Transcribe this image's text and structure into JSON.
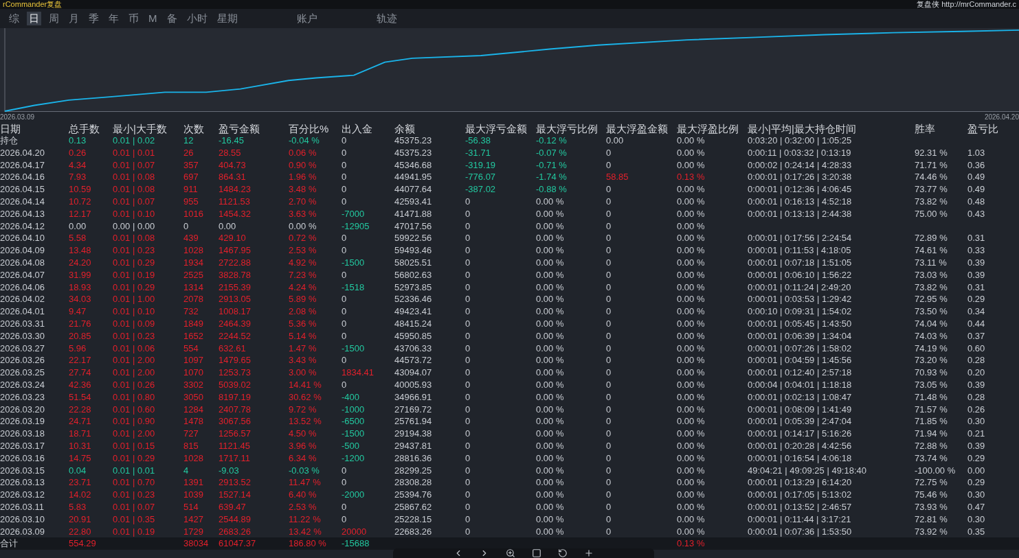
{
  "title_left": "rCommander复盘",
  "title_right": "复盘侠 http://mrCommander.c",
  "period_tabs": [
    {
      "label": "综",
      "selected": false
    },
    {
      "label": "日",
      "selected": true
    },
    {
      "label": "周",
      "selected": false
    },
    {
      "label": "月",
      "selected": false
    },
    {
      "label": "季",
      "selected": false
    },
    {
      "label": "年",
      "selected": false
    },
    {
      "label": "币",
      "selected": false
    },
    {
      "label": "M",
      "selected": false
    },
    {
      "label": "备",
      "selected": false
    },
    {
      "label": "小时",
      "selected": false
    },
    {
      "label": "星期",
      "selected": false
    }
  ],
  "view_tabs": [
    {
      "label": "账户",
      "selected": false
    },
    {
      "label": "轨迹",
      "selected": false
    }
  ],
  "chart": {
    "start_label": "2026.03.09",
    "end_label": "2026.04.20"
  },
  "table": {
    "columns": [
      "日期",
      "总手数",
      "最小|大手数",
      "次数",
      "盈亏金额",
      "百分比%",
      "出入金",
      "余额",
      "最大浮亏金额",
      "最大浮亏比例",
      "最大浮盈金额",
      "最大浮盈比例",
      "最小|平均|最大持仓时间",
      "胜率",
      "盈亏比"
    ],
    "rows": [
      {
        "cells": [
          {
            "text": "持仓"
          },
          {
            "text": "0.13",
            "color": "#22c9a0"
          },
          {
            "text": "0.01 | 0.02",
            "color": "#22c9a0"
          },
          {
            "text": "12",
            "color": "#22c9a0"
          },
          {
            "text": "-16.45",
            "color": "#22c9a0"
          },
          {
            "text": "-0.04 %",
            "color": "#22c9a0"
          },
          {
            "text": "0"
          },
          {
            "text": "45375.23"
          },
          {
            "text": "-56.38",
            "color": "#22c9a0"
          },
          {
            "text": "-0.12 %",
            "color": "#22c9a0"
          },
          {
            "text": "0.00"
          },
          {
            "text": "0.00 %"
          },
          {
            "text": "0:03:20 | 0:32:00 | 1:05:25"
          },
          null,
          null
        ]
      },
      {
        "cells": [
          {
            "text": "2026.04.20"
          },
          {
            "text": "0.26",
            "color": "#e3202b"
          },
          {
            "text": "0.01 | 0.01",
            "color": "#e3202b"
          },
          {
            "text": "26",
            "color": "#e3202b"
          },
          {
            "text": "28.55",
            "color": "#e3202b"
          },
          {
            "text": "0.06 %",
            "color": "#e3202b"
          },
          {
            "text": "0"
          },
          {
            "text": "45375.23"
          },
          {
            "text": "-31.71",
            "color": "#22c9a0"
          },
          {
            "text": "-0.07 %",
            "color": "#22c9a0"
          },
          {
            "text": "0"
          },
          {
            "text": "0.00 %"
          },
          {
            "text": "0:00:11 | 0:03:32 | 0:13:19"
          },
          {
            "text": "92.31 %"
          },
          {
            "text": "1.03"
          }
        ]
      },
      {
        "cells": [
          {
            "text": "2026.04.17"
          },
          {
            "text": "4.34",
            "color": "#e3202b"
          },
          {
            "text": "0.01 | 0.07",
            "color": "#e3202b"
          },
          {
            "text": "357",
            "color": "#e3202b"
          },
          {
            "text": "404.73",
            "color": "#e3202b"
          },
          {
            "text": "0.90 %",
            "color": "#e3202b"
          },
          {
            "text": "0"
          },
          {
            "text": "45346.68"
          },
          {
            "text": "-319.19",
            "color": "#22c9a0"
          },
          {
            "text": "-0.71 %",
            "color": "#22c9a0"
          },
          {
            "text": "0"
          },
          {
            "text": "0.00 %"
          },
          {
            "text": "0:00:02 | 0:24:14 | 4:28:33"
          },
          {
            "text": "71.71 %"
          },
          {
            "text": "0.36"
          }
        ]
      },
      {
        "cells": [
          {
            "text": "2026.04.16"
          },
          {
            "text": "7.93",
            "color": "#e3202b"
          },
          {
            "text": "0.01 | 0.08",
            "color": "#e3202b"
          },
          {
            "text": "697",
            "color": "#e3202b"
          },
          {
            "text": "864.31",
            "color": "#e3202b"
          },
          {
            "text": "1.96 %",
            "color": "#e3202b"
          },
          {
            "text": "0"
          },
          {
            "text": "44941.95"
          },
          {
            "text": "-776.07",
            "color": "#22c9a0"
          },
          {
            "text": "-1.74 %",
            "color": "#22c9a0"
          },
          {
            "text": "58.85",
            "color": "#e3202b"
          },
          {
            "text": "0.13 %",
            "color": "#e3202b"
          },
          {
            "text": "0:00:01 | 0:17:26 | 3:20:38"
          },
          {
            "text": "74.46 %"
          },
          {
            "text": "0.49"
          }
        ]
      },
      {
        "cells": [
          {
            "text": "2026.04.15"
          },
          {
            "text": "10.59",
            "color": "#e3202b"
          },
          {
            "text": "0.01 | 0.08",
            "color": "#e3202b"
          },
          {
            "text": "911",
            "color": "#e3202b"
          },
          {
            "text": "1484.23",
            "color": "#e3202b"
          },
          {
            "text": "3.48 %",
            "color": "#e3202b"
          },
          {
            "text": "0"
          },
          {
            "text": "44077.64"
          },
          {
            "text": "-387.02",
            "color": "#22c9a0"
          },
          {
            "text": "-0.88 %",
            "color": "#22c9a0"
          },
          {
            "text": "0"
          },
          {
            "text": "0.00 %"
          },
          {
            "text": "0:00:01 | 0:12:36 | 4:06:45"
          },
          {
            "text": "73.77 %"
          },
          {
            "text": "0.49"
          }
        ]
      },
      {
        "cells": [
          {
            "text": "2026.04.14"
          },
          {
            "text": "10.72",
            "color": "#e3202b"
          },
          {
            "text": "0.01 | 0.07",
            "color": "#e3202b"
          },
          {
            "text": "955",
            "color": "#e3202b"
          },
          {
            "text": "1121.53",
            "color": "#e3202b"
          },
          {
            "text": "2.70 %",
            "color": "#e3202b"
          },
          {
            "text": "0"
          },
          {
            "text": "42593.41"
          },
          {
            "text": "0"
          },
          {
            "text": "0.00 %"
          },
          {
            "text": "0"
          },
          {
            "text": "0.00 %"
          },
          {
            "text": "0:00:01 | 0:16:13 | 4:52:18"
          },
          {
            "text": "73.82 %"
          },
          {
            "text": "0.48"
          }
        ]
      },
      {
        "cells": [
          {
            "text": "2026.04.13"
          },
          {
            "text": "12.17",
            "color": "#e3202b"
          },
          {
            "text": "0.01 | 0.10",
            "color": "#e3202b"
          },
          {
            "text": "1016",
            "color": "#e3202b"
          },
          {
            "text": "1454.32",
            "color": "#e3202b"
          },
          {
            "text": "3.63 %",
            "color": "#e3202b"
          },
          {
            "text": "-7000",
            "color": "#22c9a0"
          },
          {
            "text": "41471.88"
          },
          {
            "text": "0"
          },
          {
            "text": "0.00 %"
          },
          {
            "text": "0"
          },
          {
            "text": "0.00 %"
          },
          {
            "text": "0:00:01 | 0:13:13 | 2:44:38"
          },
          {
            "text": "75.00 %"
          },
          {
            "text": "0.43"
          }
        ]
      },
      {
        "cells": [
          {
            "text": "2026.04.12"
          },
          {
            "text": "0.00"
          },
          {
            "text": "0.00 | 0.00"
          },
          {
            "text": "0"
          },
          {
            "text": "0.00"
          },
          {
            "text": "0.00 %"
          },
          {
            "text": "-12905",
            "color": "#22c9a0"
          },
          {
            "text": "47017.56"
          },
          {
            "text": "0"
          },
          {
            "text": "0.00 %"
          },
          {
            "text": "0"
          },
          {
            "text": "0.00 %"
          },
          null,
          null,
          null
        ]
      },
      {
        "cells": [
          {
            "text": "2026.04.10"
          },
          {
            "text": "5.58",
            "color": "#e3202b"
          },
          {
            "text": "0.01 | 0.08",
            "color": "#e3202b"
          },
          {
            "text": "439",
            "color": "#e3202b"
          },
          {
            "text": "429.10",
            "color": "#e3202b"
          },
          {
            "text": "0.72 %",
            "color": "#e3202b"
          },
          {
            "text": "0"
          },
          {
            "text": "59922.56"
          },
          {
            "text": "0"
          },
          {
            "text": "0.00 %"
          },
          {
            "text": "0"
          },
          {
            "text": "0.00 %"
          },
          {
            "text": "0:00:01 | 0:17:56 | 2:24:54"
          },
          {
            "text": "72.89 %"
          },
          {
            "text": "0.31"
          }
        ]
      },
      {
        "cells": [
          {
            "text": "2026.04.09"
          },
          {
            "text": "13.48",
            "color": "#e3202b"
          },
          {
            "text": "0.01 | 0.23",
            "color": "#e3202b"
          },
          {
            "text": "1028",
            "color": "#e3202b"
          },
          {
            "text": "1467.95",
            "color": "#e3202b"
          },
          {
            "text": "2.53 %",
            "color": "#e3202b"
          },
          {
            "text": "0"
          },
          {
            "text": "59493.46"
          },
          {
            "text": "0"
          },
          {
            "text": "0.00 %"
          },
          {
            "text": "0"
          },
          {
            "text": "0.00 %"
          },
          {
            "text": "0:00:01 | 0:11:53 | 4:18:05"
          },
          {
            "text": "74.61 %"
          },
          {
            "text": "0.33"
          }
        ]
      },
      {
        "cells": [
          {
            "text": "2026.04.08"
          },
          {
            "text": "24.20",
            "color": "#e3202b"
          },
          {
            "text": "0.01 | 0.29",
            "color": "#e3202b"
          },
          {
            "text": "1934",
            "color": "#e3202b"
          },
          {
            "text": "2722.88",
            "color": "#e3202b"
          },
          {
            "text": "4.92 %",
            "color": "#e3202b"
          },
          {
            "text": "-1500",
            "color": "#22c9a0"
          },
          {
            "text": "58025.51"
          },
          {
            "text": "0"
          },
          {
            "text": "0.00 %"
          },
          {
            "text": "0"
          },
          {
            "text": "0.00 %"
          },
          {
            "text": "0:00:01 | 0:07:18 | 1:51:05"
          },
          {
            "text": "73.11 %"
          },
          {
            "text": "0.39"
          }
        ]
      },
      {
        "cells": [
          {
            "text": "2026.04.07"
          },
          {
            "text": "31.99",
            "color": "#e3202b"
          },
          {
            "text": "0.01 | 0.19",
            "color": "#e3202b"
          },
          {
            "text": "2525",
            "color": "#e3202b"
          },
          {
            "text": "3828.78",
            "color": "#e3202b"
          },
          {
            "text": "7.23 %",
            "color": "#e3202b"
          },
          {
            "text": "0"
          },
          {
            "text": "56802.63"
          },
          {
            "text": "0"
          },
          {
            "text": "0.00 %"
          },
          {
            "text": "0"
          },
          {
            "text": "0.00 %"
          },
          {
            "text": "0:00:01 | 0:06:10 | 1:56:22"
          },
          {
            "text": "73.03 %"
          },
          {
            "text": "0.39"
          }
        ]
      },
      {
        "cells": [
          {
            "text": "2026.04.06"
          },
          {
            "text": "18.93",
            "color": "#e3202b"
          },
          {
            "text": "0.01 | 0.29",
            "color": "#e3202b"
          },
          {
            "text": "1314",
            "color": "#e3202b"
          },
          {
            "text": "2155.39",
            "color": "#e3202b"
          },
          {
            "text": "4.24 %",
            "color": "#e3202b"
          },
          {
            "text": "-1518",
            "color": "#22c9a0"
          },
          {
            "text": "52973.85"
          },
          {
            "text": "0"
          },
          {
            "text": "0.00 %"
          },
          {
            "text": "0"
          },
          {
            "text": "0.00 %"
          },
          {
            "text": "0:00:01 | 0:11:24 | 2:49:20"
          },
          {
            "text": "73.82 %"
          },
          {
            "text": "0.31"
          }
        ]
      },
      {
        "cells": [
          {
            "text": "2026.04.02"
          },
          {
            "text": "34.03",
            "color": "#e3202b"
          },
          {
            "text": "0.01 | 1.00",
            "color": "#e3202b"
          },
          {
            "text": "2078",
            "color": "#e3202b"
          },
          {
            "text": "2913.05",
            "color": "#e3202b"
          },
          {
            "text": "5.89 %",
            "color": "#e3202b"
          },
          {
            "text": "0"
          },
          {
            "text": "52336.46"
          },
          {
            "text": "0"
          },
          {
            "text": "0.00 %"
          },
          {
            "text": "0"
          },
          {
            "text": "0.00 %"
          },
          {
            "text": "0:00:01 | 0:03:53 | 1:29:42"
          },
          {
            "text": "72.95 %"
          },
          {
            "text": "0.29"
          }
        ]
      },
      {
        "cells": [
          {
            "text": "2026.04.01"
          },
          {
            "text": "9.47",
            "color": "#e3202b"
          },
          {
            "text": "0.01 | 0.10",
            "color": "#e3202b"
          },
          {
            "text": "732",
            "color": "#e3202b"
          },
          {
            "text": "1008.17",
            "color": "#e3202b"
          },
          {
            "text": "2.08 %",
            "color": "#e3202b"
          },
          {
            "text": "0"
          },
          {
            "text": "49423.41"
          },
          {
            "text": "0"
          },
          {
            "text": "0.00 %"
          },
          {
            "text": "0"
          },
          {
            "text": "0.00 %"
          },
          {
            "text": "0:00:10 | 0:09:31 | 1:54:02"
          },
          {
            "text": "73.50 %"
          },
          {
            "text": "0.34"
          }
        ]
      },
      {
        "cells": [
          {
            "text": "2026.03.31"
          },
          {
            "text": "21.76",
            "color": "#e3202b"
          },
          {
            "text": "0.01 | 0.09",
            "color": "#e3202b"
          },
          {
            "text": "1849",
            "color": "#e3202b"
          },
          {
            "text": "2464.39",
            "color": "#e3202b"
          },
          {
            "text": "5.36 %",
            "color": "#e3202b"
          },
          {
            "text": "0"
          },
          {
            "text": "48415.24"
          },
          {
            "text": "0"
          },
          {
            "text": "0.00 %"
          },
          {
            "text": "0"
          },
          {
            "text": "0.00 %"
          },
          {
            "text": "0:00:01 | 0:05:45 | 1:43:50"
          },
          {
            "text": "74.04 %"
          },
          {
            "text": "0.44"
          }
        ]
      },
      {
        "cells": [
          {
            "text": "2026.03.30"
          },
          {
            "text": "20.85",
            "color": "#e3202b"
          },
          {
            "text": "0.01 | 0.23",
            "color": "#e3202b"
          },
          {
            "text": "1652",
            "color": "#e3202b"
          },
          {
            "text": "2244.52",
            "color": "#e3202b"
          },
          {
            "text": "5.14 %",
            "color": "#e3202b"
          },
          {
            "text": "0"
          },
          {
            "text": "45950.85"
          },
          {
            "text": "0"
          },
          {
            "text": "0.00 %"
          },
          {
            "text": "0"
          },
          {
            "text": "0.00 %"
          },
          {
            "text": "0:00:01 | 0:06:39 | 1:34:04"
          },
          {
            "text": "74.03 %"
          },
          {
            "text": "0.37"
          }
        ]
      },
      {
        "cells": [
          {
            "text": "2026.03.27"
          },
          {
            "text": "5.96",
            "color": "#e3202b"
          },
          {
            "text": "0.01 | 0.06",
            "color": "#e3202b"
          },
          {
            "text": "554",
            "color": "#e3202b"
          },
          {
            "text": "632.61",
            "color": "#e3202b"
          },
          {
            "text": "1.47 %",
            "color": "#e3202b"
          },
          {
            "text": "-1500",
            "color": "#22c9a0"
          },
          {
            "text": "43706.33"
          },
          {
            "text": "0"
          },
          {
            "text": "0.00 %"
          },
          {
            "text": "0"
          },
          {
            "text": "0.00 %"
          },
          {
            "text": "0:00:01 | 0:07:26 | 1:58:02"
          },
          {
            "text": "74.19 %"
          },
          {
            "text": "0.60"
          }
        ]
      },
      {
        "cells": [
          {
            "text": "2026.03.26"
          },
          {
            "text": "22.17",
            "color": "#e3202b"
          },
          {
            "text": "0.01 | 2.00",
            "color": "#e3202b"
          },
          {
            "text": "1097",
            "color": "#e3202b"
          },
          {
            "text": "1479.65",
            "color": "#e3202b"
          },
          {
            "text": "3.43 %",
            "color": "#e3202b"
          },
          {
            "text": "0"
          },
          {
            "text": "44573.72"
          },
          {
            "text": "0"
          },
          {
            "text": "0.00 %"
          },
          {
            "text": "0"
          },
          {
            "text": "0.00 %"
          },
          {
            "text": "0:00:01 | 0:04:59 | 1:45:56"
          },
          {
            "text": "73.20 %"
          },
          {
            "text": "0.28"
          }
        ]
      },
      {
        "cells": [
          {
            "text": "2026.03.25"
          },
          {
            "text": "27.74",
            "color": "#e3202b"
          },
          {
            "text": "0.01 | 2.00",
            "color": "#e3202b"
          },
          {
            "text": "1070",
            "color": "#e3202b"
          },
          {
            "text": "1253.73",
            "color": "#e3202b"
          },
          {
            "text": "3.00 %",
            "color": "#e3202b"
          },
          {
            "text": "1834.41",
            "color": "#e3202b"
          },
          {
            "text": "43094.07"
          },
          {
            "text": "0"
          },
          {
            "text": "0.00 %"
          },
          {
            "text": "0"
          },
          {
            "text": "0.00 %"
          },
          {
            "text": "0:00:01 | 0:12:40 | 2:57:18"
          },
          {
            "text": "70.93 %"
          },
          {
            "text": "0.20"
          }
        ]
      },
      {
        "cells": [
          {
            "text": "2026.03.24"
          },
          {
            "text": "42.36",
            "color": "#e3202b"
          },
          {
            "text": "0.01 | 0.26",
            "color": "#e3202b"
          },
          {
            "text": "3302",
            "color": "#e3202b"
          },
          {
            "text": "5039.02",
            "color": "#e3202b"
          },
          {
            "text": "14.41 %",
            "color": "#e3202b"
          },
          {
            "text": "0"
          },
          {
            "text": "40005.93"
          },
          {
            "text": "0"
          },
          {
            "text": "0.00 %"
          },
          {
            "text": "0"
          },
          {
            "text": "0.00 %"
          },
          {
            "text": "0:00:04 | 0:04:01 | 1:18:18"
          },
          {
            "text": "73.05 %"
          },
          {
            "text": "0.39"
          }
        ]
      },
      {
        "cells": [
          {
            "text": "2026.03.23"
          },
          {
            "text": "51.54",
            "color": "#e3202b"
          },
          {
            "text": "0.01 | 0.80",
            "color": "#e3202b"
          },
          {
            "text": "3050",
            "color": "#e3202b"
          },
          {
            "text": "8197.19",
            "color": "#e3202b"
          },
          {
            "text": "30.62 %",
            "color": "#e3202b"
          },
          {
            "text": "-400",
            "color": "#22c9a0"
          },
          {
            "text": "34966.91"
          },
          {
            "text": "0"
          },
          {
            "text": "0.00 %"
          },
          {
            "text": "0"
          },
          {
            "text": "0.00 %"
          },
          {
            "text": "0:00:01 | 0:02:13 | 1:08:47"
          },
          {
            "text": "71.48 %"
          },
          {
            "text": "0.28"
          }
        ]
      },
      {
        "cells": [
          {
            "text": "2026.03.20"
          },
          {
            "text": "22.28",
            "color": "#e3202b"
          },
          {
            "text": "0.01 | 0.60",
            "color": "#e3202b"
          },
          {
            "text": "1284",
            "color": "#e3202b"
          },
          {
            "text": "2407.78",
            "color": "#e3202b"
          },
          {
            "text": "9.72 %",
            "color": "#e3202b"
          },
          {
            "text": "-1000",
            "color": "#22c9a0"
          },
          {
            "text": "27169.72"
          },
          {
            "text": "0"
          },
          {
            "text": "0.00 %"
          },
          {
            "text": "0"
          },
          {
            "text": "0.00 %"
          },
          {
            "text": "0:00:01 | 0:08:09 | 1:41:49"
          },
          {
            "text": "71.57 %"
          },
          {
            "text": "0.26"
          }
        ]
      },
      {
        "cells": [
          {
            "text": "2026.03.19"
          },
          {
            "text": "24.71",
            "color": "#e3202b"
          },
          {
            "text": "0.01 | 0.90",
            "color": "#e3202b"
          },
          {
            "text": "1478",
            "color": "#e3202b"
          },
          {
            "text": "3067.56",
            "color": "#e3202b"
          },
          {
            "text": "13.52 %",
            "color": "#e3202b"
          },
          {
            "text": "-6500",
            "color": "#22c9a0"
          },
          {
            "text": "25761.94"
          },
          {
            "text": "0"
          },
          {
            "text": "0.00 %"
          },
          {
            "text": "0"
          },
          {
            "text": "0.00 %"
          },
          {
            "text": "0:00:01 | 0:05:39 | 2:47:04"
          },
          {
            "text": "71.85 %"
          },
          {
            "text": "0.30"
          }
        ]
      },
      {
        "cells": [
          {
            "text": "2026.03.18"
          },
          {
            "text": "18.71",
            "color": "#e3202b"
          },
          {
            "text": "0.01 | 2.00",
            "color": "#e3202b"
          },
          {
            "text": "727",
            "color": "#e3202b"
          },
          {
            "text": "1256.57",
            "color": "#e3202b"
          },
          {
            "text": "4.50 %",
            "color": "#e3202b"
          },
          {
            "text": "-1500",
            "color": "#22c9a0"
          },
          {
            "text": "29194.38"
          },
          {
            "text": "0"
          },
          {
            "text": "0.00 %"
          },
          {
            "text": "0"
          },
          {
            "text": "0.00 %"
          },
          {
            "text": "0:00:01 | 0:14:17 | 5:16:26"
          },
          {
            "text": "71.94 %"
          },
          {
            "text": "0.21"
          }
        ]
      },
      {
        "cells": [
          {
            "text": "2026.03.17"
          },
          {
            "text": "10.31",
            "color": "#e3202b"
          },
          {
            "text": "0.01 | 0.15",
            "color": "#e3202b"
          },
          {
            "text": "815",
            "color": "#e3202b"
          },
          {
            "text": "1121.45",
            "color": "#e3202b"
          },
          {
            "text": "3.96 %",
            "color": "#e3202b"
          },
          {
            "text": "-500",
            "color": "#22c9a0"
          },
          {
            "text": "29437.81"
          },
          {
            "text": "0"
          },
          {
            "text": "0.00 %"
          },
          {
            "text": "0"
          },
          {
            "text": "0.00 %"
          },
          {
            "text": "0:00:01 | 0:20:28 | 4:42:56"
          },
          {
            "text": "72.88 %"
          },
          {
            "text": "0.39"
          }
        ]
      },
      {
        "cells": [
          {
            "text": "2026.03.16"
          },
          {
            "text": "14.75",
            "color": "#e3202b"
          },
          {
            "text": "0.01 | 0.29",
            "color": "#e3202b"
          },
          {
            "text": "1028",
            "color": "#e3202b"
          },
          {
            "text": "1717.11",
            "color": "#e3202b"
          },
          {
            "text": "6.34 %",
            "color": "#e3202b"
          },
          {
            "text": "-1200",
            "color": "#22c9a0"
          },
          {
            "text": "28816.36"
          },
          {
            "text": "0"
          },
          {
            "text": "0.00 %"
          },
          {
            "text": "0"
          },
          {
            "text": "0.00 %"
          },
          {
            "text": "0:00:01 | 0:16:54 | 4:06:18"
          },
          {
            "text": "73.74 %"
          },
          {
            "text": "0.29"
          }
        ]
      },
      {
        "cells": [
          {
            "text": "2026.03.15"
          },
          {
            "text": "0.04",
            "color": "#22c9a0"
          },
          {
            "text": "0.01 | 0.01",
            "color": "#22c9a0"
          },
          {
            "text": "4",
            "color": "#22c9a0"
          },
          {
            "text": "-9.03",
            "color": "#22c9a0"
          },
          {
            "text": "-0.03 %",
            "color": "#22c9a0"
          },
          {
            "text": "0"
          },
          {
            "text": "28299.25"
          },
          {
            "text": "0"
          },
          {
            "text": "0.00 %"
          },
          {
            "text": "0"
          },
          {
            "text": "0.00 %"
          },
          {
            "text": "49:04:21 | 49:09:25 | 49:18:40"
          },
          {
            "text": "-100.00 %"
          },
          {
            "text": "0.00"
          }
        ]
      },
      {
        "cells": [
          {
            "text": "2026.03.13"
          },
          {
            "text": "23.71",
            "color": "#e3202b"
          },
          {
            "text": "0.01 | 0.70",
            "color": "#e3202b"
          },
          {
            "text": "1391",
            "color": "#e3202b"
          },
          {
            "text": "2913.52",
            "color": "#e3202b"
          },
          {
            "text": "11.47 %",
            "color": "#e3202b"
          },
          {
            "text": "0"
          },
          {
            "text": "28308.28"
          },
          {
            "text": "0"
          },
          {
            "text": "0.00 %"
          },
          {
            "text": "0"
          },
          {
            "text": "0.00 %"
          },
          {
            "text": "0:00:01 | 0:13:29 | 6:14:20"
          },
          {
            "text": "72.75 %"
          },
          {
            "text": "0.29"
          }
        ]
      },
      {
        "cells": [
          {
            "text": "2026.03.12"
          },
          {
            "text": "14.02",
            "color": "#e3202b"
          },
          {
            "text": "0.01 | 0.23",
            "color": "#e3202b"
          },
          {
            "text": "1039",
            "color": "#e3202b"
          },
          {
            "text": "1527.14",
            "color": "#e3202b"
          },
          {
            "text": "6.40 %",
            "color": "#e3202b"
          },
          {
            "text": "-2000",
            "color": "#22c9a0"
          },
          {
            "text": "25394.76"
          },
          {
            "text": "0"
          },
          {
            "text": "0.00 %"
          },
          {
            "text": "0"
          },
          {
            "text": "0.00 %"
          },
          {
            "text": "0:00:01 | 0:17:05 | 5:13:02"
          },
          {
            "text": "75.46 %"
          },
          {
            "text": "0.30"
          }
        ]
      },
      {
        "cells": [
          {
            "text": "2026.03.11"
          },
          {
            "text": "5.83",
            "color": "#e3202b"
          },
          {
            "text": "0.01 | 0.07",
            "color": "#e3202b"
          },
          {
            "text": "514",
            "color": "#e3202b"
          },
          {
            "text": "639.47",
            "color": "#e3202b"
          },
          {
            "text": "2.53 %",
            "color": "#e3202b"
          },
          {
            "text": "0"
          },
          {
            "text": "25867.62"
          },
          {
            "text": "0"
          },
          {
            "text": "0.00 %"
          },
          {
            "text": "0"
          },
          {
            "text": "0.00 %"
          },
          {
            "text": "0:00:01 | 0:13:52 | 2:46:57"
          },
          {
            "text": "73.93 %"
          },
          {
            "text": "0.47"
          }
        ]
      },
      {
        "cells": [
          {
            "text": "2026.03.10"
          },
          {
            "text": "20.91",
            "color": "#e3202b"
          },
          {
            "text": "0.01 | 0.35",
            "color": "#e3202b"
          },
          {
            "text": "1427",
            "color": "#e3202b"
          },
          {
            "text": "2544.89",
            "color": "#e3202b"
          },
          {
            "text": "11.22 %",
            "color": "#e3202b"
          },
          {
            "text": "0"
          },
          {
            "text": "25228.15"
          },
          {
            "text": "0"
          },
          {
            "text": "0.00 %"
          },
          {
            "text": "0"
          },
          {
            "text": "0.00 %"
          },
          {
            "text": "0:00:01 | 0:11:44 | 3:17:21"
          },
          {
            "text": "72.81 %"
          },
          {
            "text": "0.30"
          }
        ]
      },
      {
        "cells": [
          {
            "text": "2026.03.09"
          },
          {
            "text": "22.80",
            "color": "#e3202b"
          },
          {
            "text": "0.01 | 0.19",
            "color": "#e3202b"
          },
          {
            "text": "1729",
            "color": "#e3202b"
          },
          {
            "text": "2683.26",
            "color": "#e3202b"
          },
          {
            "text": "13.42 %",
            "color": "#e3202b"
          },
          {
            "text": "20000",
            "color": "#e3202b"
          },
          {
            "text": "22683.26"
          },
          {
            "text": "0"
          },
          {
            "text": "0.00 %"
          },
          {
            "text": "0"
          },
          {
            "text": "0.00 %"
          },
          {
            "text": "0:00:01 | 0:07:36 | 1:53:50"
          },
          {
            "text": "73.92 %"
          },
          {
            "text": "0.35"
          }
        ]
      }
    ],
    "totals": {
      "cells": [
        {
          "text": "合计"
        },
        {
          "text": "554.29",
          "color": "#e3202b"
        },
        null,
        {
          "text": "38034",
          "color": "#e3202b"
        },
        {
          "text": "61047.37",
          "color": "#e3202b"
        },
        {
          "text": "186.80 %",
          "color": "#e3202b"
        },
        {
          "text": "-15688",
          "color": "#22c9a0"
        },
        null,
        null,
        null,
        null,
        {
          "text": "0.13 %",
          "color": "#e3202b"
        },
        null,
        null,
        null
      ]
    }
  }
}
